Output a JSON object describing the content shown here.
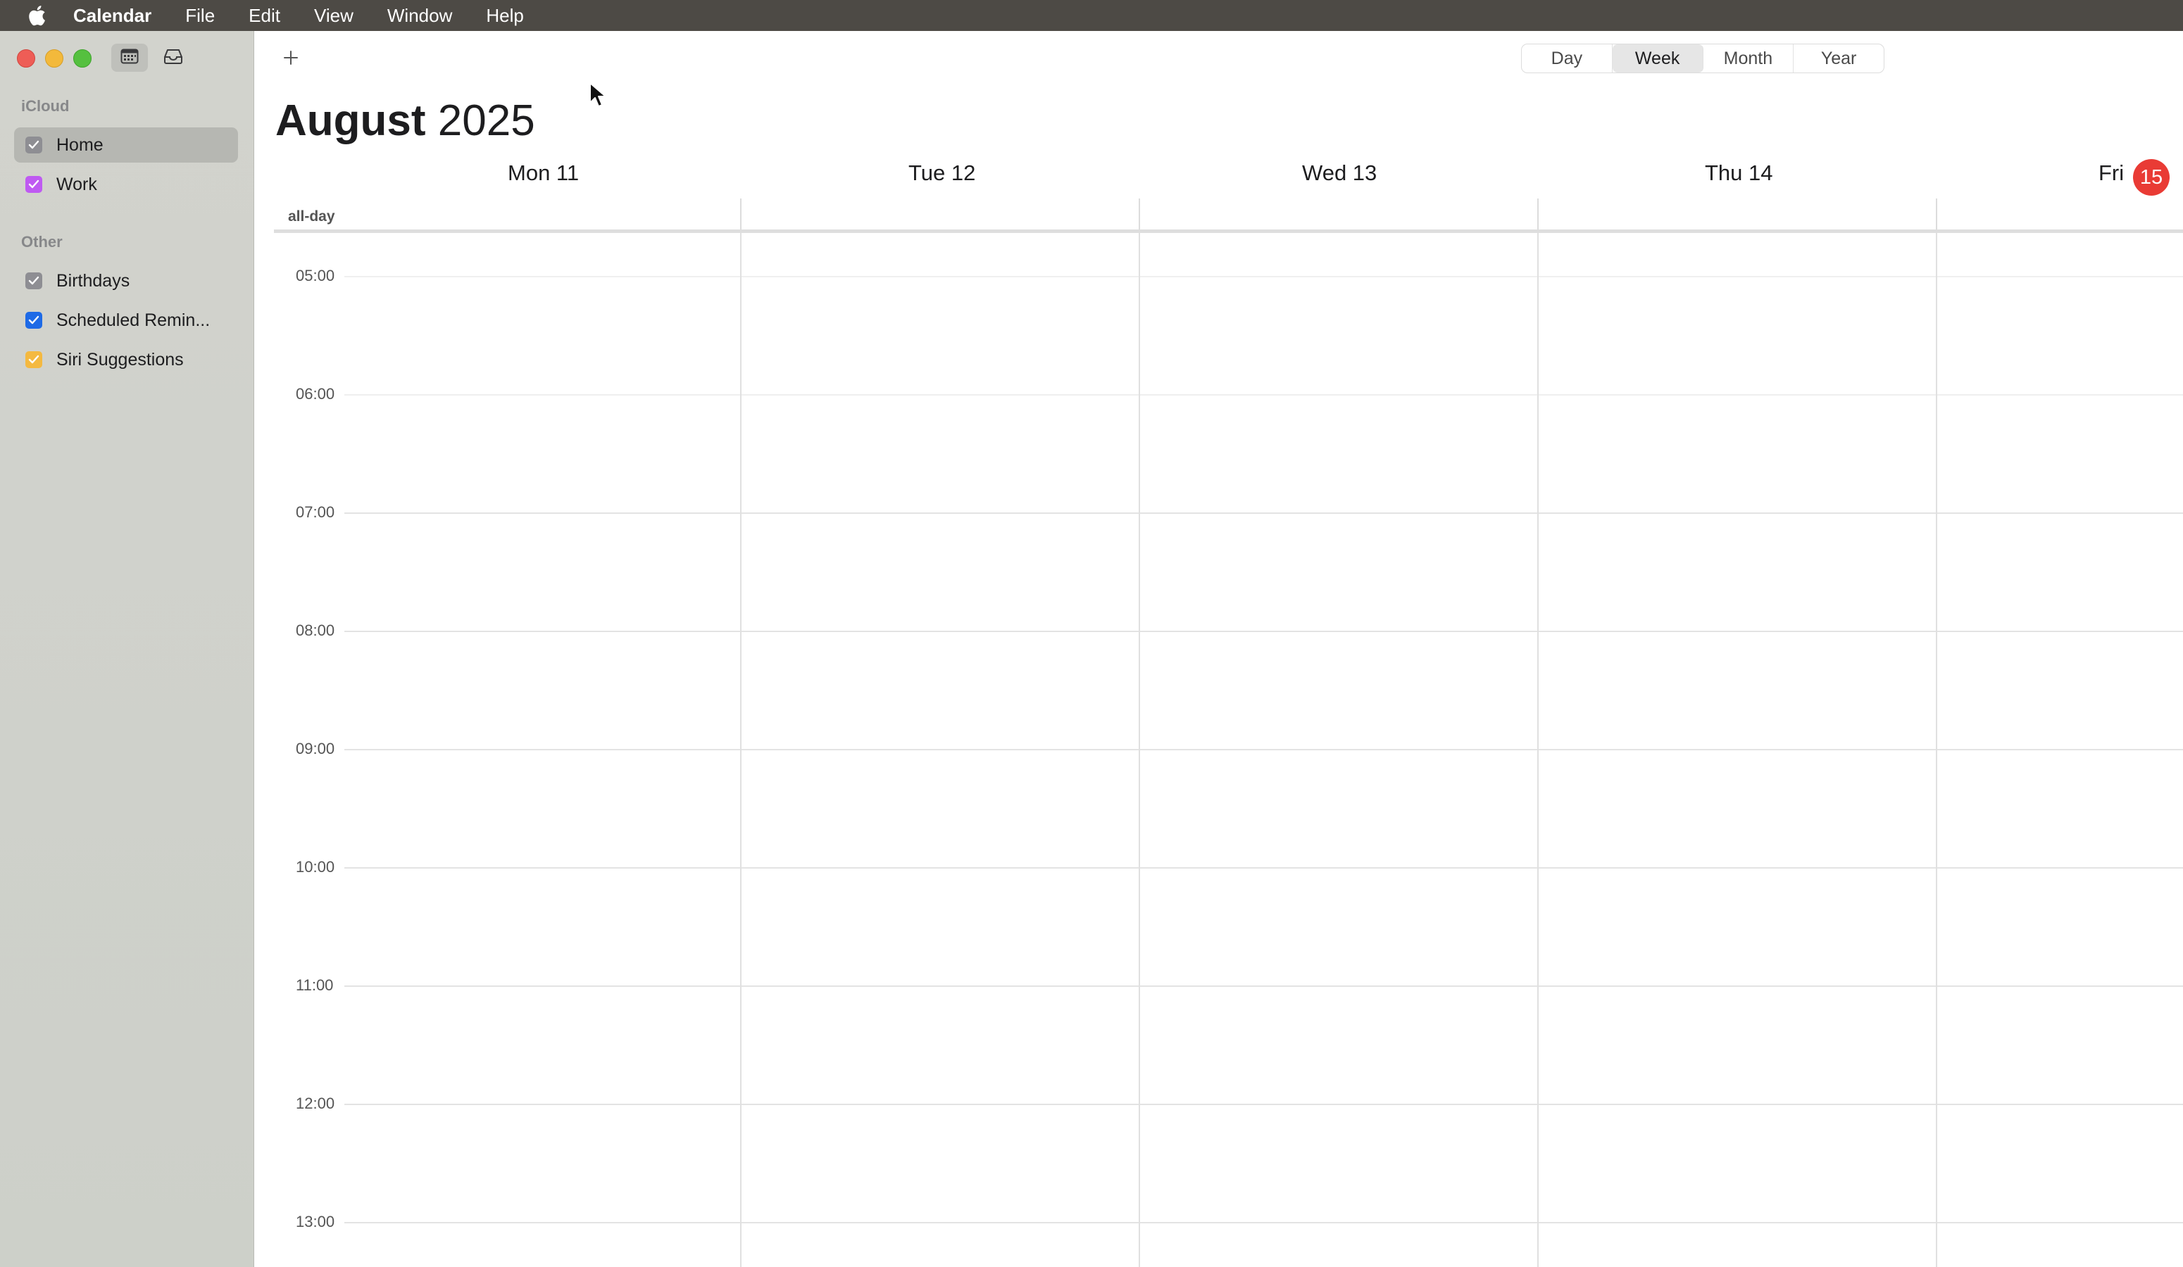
{
  "menubar": {
    "apple_icon": "apple-logo-icon",
    "app_name": "Calendar",
    "items": [
      "File",
      "Edit",
      "View",
      "Window",
      "Help"
    ]
  },
  "sidebar": {
    "sections": [
      {
        "title": "iCloud",
        "items": [
          {
            "label": "Home",
            "color": "#8e8e93",
            "checked": true,
            "selected": true
          },
          {
            "label": "Work",
            "color": "#bf5af2",
            "checked": true,
            "selected": false
          }
        ]
      },
      {
        "title": "Other",
        "items": [
          {
            "label": "Birthdays",
            "color": "#8e8e93",
            "checked": true,
            "selected": false
          },
          {
            "label": "Scheduled Remin...",
            "color": "#1e6ae6",
            "checked": true,
            "selected": false
          },
          {
            "label": "Siri Suggestions",
            "color": "#f4b940",
            "checked": true,
            "selected": false
          }
        ]
      }
    ]
  },
  "toolbar": {
    "add_icon": "plus-icon",
    "views": [
      {
        "label": "Day",
        "active": false
      },
      {
        "label": "Week",
        "active": true
      },
      {
        "label": "Month",
        "active": false
      },
      {
        "label": "Year",
        "active": false
      }
    ]
  },
  "header": {
    "month": "August",
    "year": "2025"
  },
  "week": {
    "days": [
      {
        "label": "Mon 11"
      },
      {
        "label": "Tue 12"
      },
      {
        "label": "Wed 13"
      },
      {
        "label": "Thu 14"
      },
      {
        "label": "Fri",
        "today_number": "15"
      }
    ],
    "allday_label": "all-day",
    "hours": [
      "05:00",
      "06:00",
      "07:00",
      "08:00",
      "09:00",
      "10:00",
      "11:00",
      "12:00",
      "13:00"
    ]
  },
  "colors": {
    "today": "#e93b35",
    "sidebar_bg": "#d0d2cc",
    "selected_item": "#b6b7b2"
  }
}
